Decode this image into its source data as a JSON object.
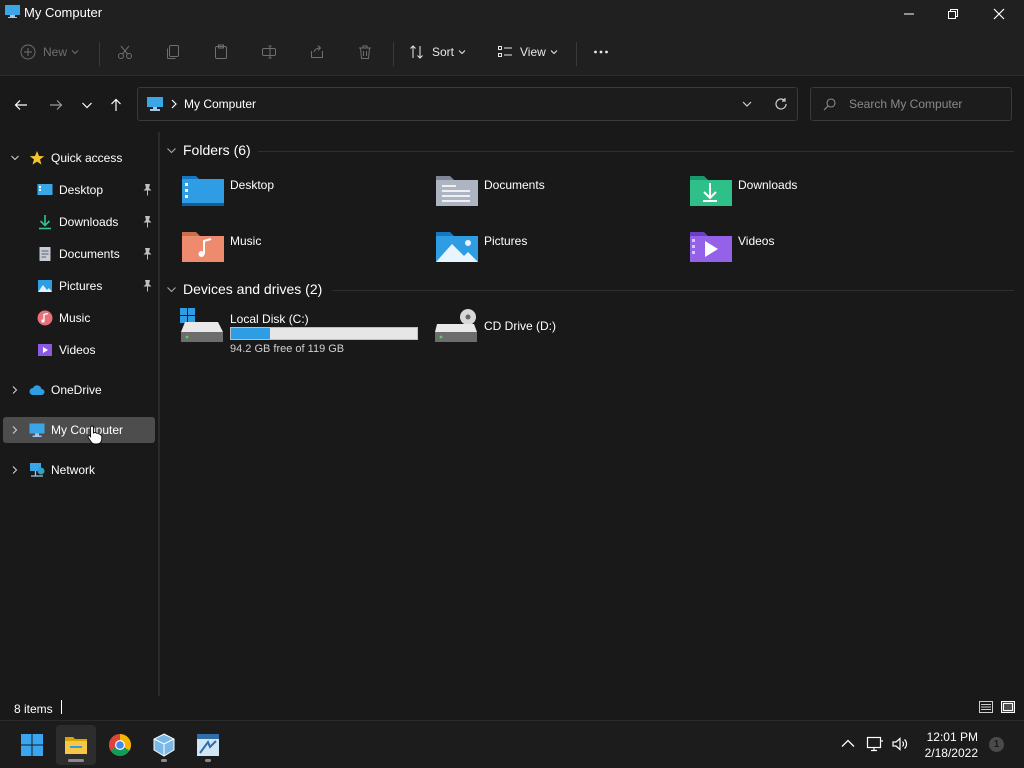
{
  "window": {
    "title": "My Computer"
  },
  "commandbar": {
    "new_label": "New",
    "sort_label": "Sort",
    "view_label": "View"
  },
  "address": {
    "crumb": "My Computer",
    "search_placeholder": "Search My Computer"
  },
  "sidebar": {
    "quick_access": "Quick access",
    "items": [
      {
        "label": "Desktop",
        "icon": "desktop-icon",
        "pinned": true
      },
      {
        "label": "Downloads",
        "icon": "downloads-icon",
        "pinned": true
      },
      {
        "label": "Documents",
        "icon": "documents-icon",
        "pinned": true
      },
      {
        "label": "Pictures",
        "icon": "pictures-icon",
        "pinned": true
      },
      {
        "label": "Music",
        "icon": "music-icon",
        "pinned": false
      },
      {
        "label": "Videos",
        "icon": "videos-icon",
        "pinned": false
      }
    ],
    "onedrive": "OneDrive",
    "my_computer": "My Computer",
    "network": "Network"
  },
  "content": {
    "folders_header": "Folders (6)",
    "folders": [
      {
        "name": "Desktop",
        "icon": "desktop-folder-icon"
      },
      {
        "name": "Documents",
        "icon": "documents-folder-icon"
      },
      {
        "name": "Downloads",
        "icon": "downloads-folder-icon"
      },
      {
        "name": "Music",
        "icon": "music-folder-icon"
      },
      {
        "name": "Pictures",
        "icon": "pictures-folder-icon"
      },
      {
        "name": "Videos",
        "icon": "videos-folder-icon"
      }
    ],
    "drives_header": "Devices and drives (2)",
    "drives": [
      {
        "name": "Local Disk (C:)",
        "free_text": "94.2 GB free of 119 GB",
        "used_fraction": 0.21
      },
      {
        "name": "CD Drive (D:)"
      }
    ]
  },
  "status": {
    "item_count": "8 items"
  },
  "taskbar": {
    "time": "12:01 PM",
    "date": "2/18/2022",
    "notification_count": "1"
  },
  "colors": {
    "accent": "#2f9de4",
    "selected_bg": "#4d4d4d",
    "window_bg": "#191919"
  }
}
